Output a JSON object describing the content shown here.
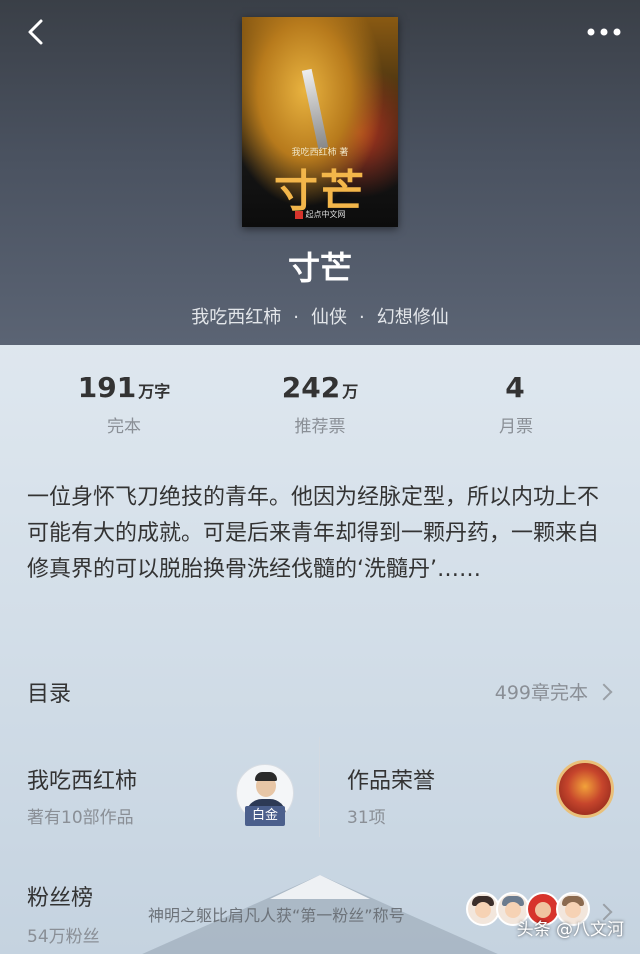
{
  "book": {
    "title": "寸芒",
    "author": "我吃西红柿",
    "category": "仙侠",
    "subcategory": "幻想修仙",
    "separator": "·",
    "cover": {
      "title": "寸芒",
      "author_line": "我吃西红柿 著",
      "publisher": "起点中文网"
    }
  },
  "stats": [
    {
      "value": "191",
      "unit": "万字",
      "label": "完本"
    },
    {
      "value": "242",
      "unit": "万",
      "label": "推荐票"
    },
    {
      "value": "4",
      "unit": "",
      "label": "月票"
    }
  ],
  "description": "一位身怀飞刀绝技的青年。他因为经脉定型，所以内功上不可能有大的成就。可是后来青年却得到一颗丹药，一颗来自修真界的可以脱胎换骨洗经伐髓的‘洗髓丹’……",
  "toc": {
    "label": "目录",
    "value": "499章完本"
  },
  "author_card": {
    "name": "我吃西红柿",
    "works": "著有10部作品",
    "badge": "白金"
  },
  "honor_card": {
    "title": "作品荣誉",
    "count": "31项"
  },
  "fans": {
    "title": "粉丝榜",
    "count": "54万粉丝",
    "note": "神明之躯比肩凡人获“第一粉丝”称号"
  },
  "watermark": "头条 @八文河",
  "colors": {
    "header_bg": "#4a5260",
    "text_primary": "#333333",
    "text_secondary": "#8a8f96",
    "accent_platinum": "#4b5f8c"
  },
  "icons": {
    "back": "chevron-left-icon",
    "more": "more-dots-icon",
    "forward": "chevron-right-icon"
  }
}
